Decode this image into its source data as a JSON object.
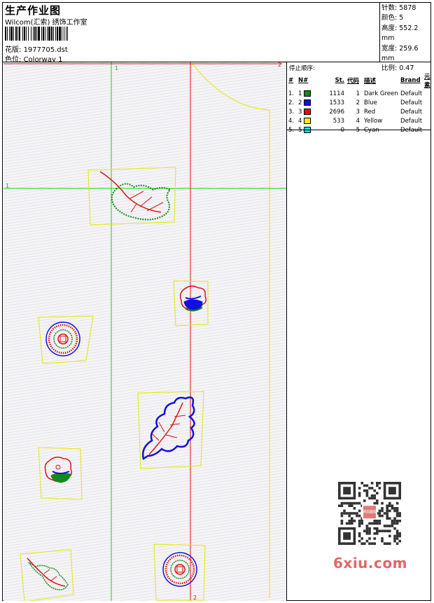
{
  "header": {
    "title": "生产作业图",
    "company": "Wilcom(汇索) 绣饰工作室",
    "design_label": "花版:",
    "design_value": "1977705.dst",
    "color_label": "色位:",
    "color_value": "Colorway 1"
  },
  "stats": [
    {
      "label": "针数:",
      "value": "5878"
    },
    {
      "label": "颜色:",
      "value": "5"
    },
    {
      "label": "高度:",
      "value": "552.2 mm"
    },
    {
      "label": "宽度:",
      "value": "259.6 mm"
    },
    {
      "label": "比例:",
      "value": "0.47"
    }
  ],
  "guides": {
    "vertical_green": "1",
    "horizontal_green": "1",
    "horizontal_red": "2",
    "vertical_red": "2"
  },
  "stop_sequence": {
    "label": "停止顺序:",
    "columns": [
      "#",
      "N#",
      "St.",
      "代码",
      "描述",
      "Brand",
      "元素"
    ],
    "rows": [
      {
        "no": "1.",
        "n": "1",
        "color": "#138a1a",
        "stitches": "1114",
        "code": "1",
        "desc": "Dark Green",
        "brand": "Default"
      },
      {
        "no": "2.",
        "n": "2",
        "color": "#1010e0",
        "stitches": "1533",
        "code": "2",
        "desc": "Blue",
        "brand": "Default"
      },
      {
        "no": "3.",
        "n": "3",
        "color": "#e01010",
        "stitches": "2696",
        "code": "3",
        "desc": "Red",
        "brand": "Default"
      },
      {
        "no": "4.",
        "n": "4",
        "color": "#f0f000",
        "stitches": "533",
        "code": "4",
        "desc": "Yellow",
        "brand": "Default"
      },
      {
        "no": "5.",
        "n": "5",
        "color": "#10e0e0",
        "stitches": "0",
        "code": "5",
        "desc": "Cyan",
        "brand": "Default"
      }
    ]
  },
  "watermark": "6xiu.com",
  "qr_stamp": "绣花图版"
}
